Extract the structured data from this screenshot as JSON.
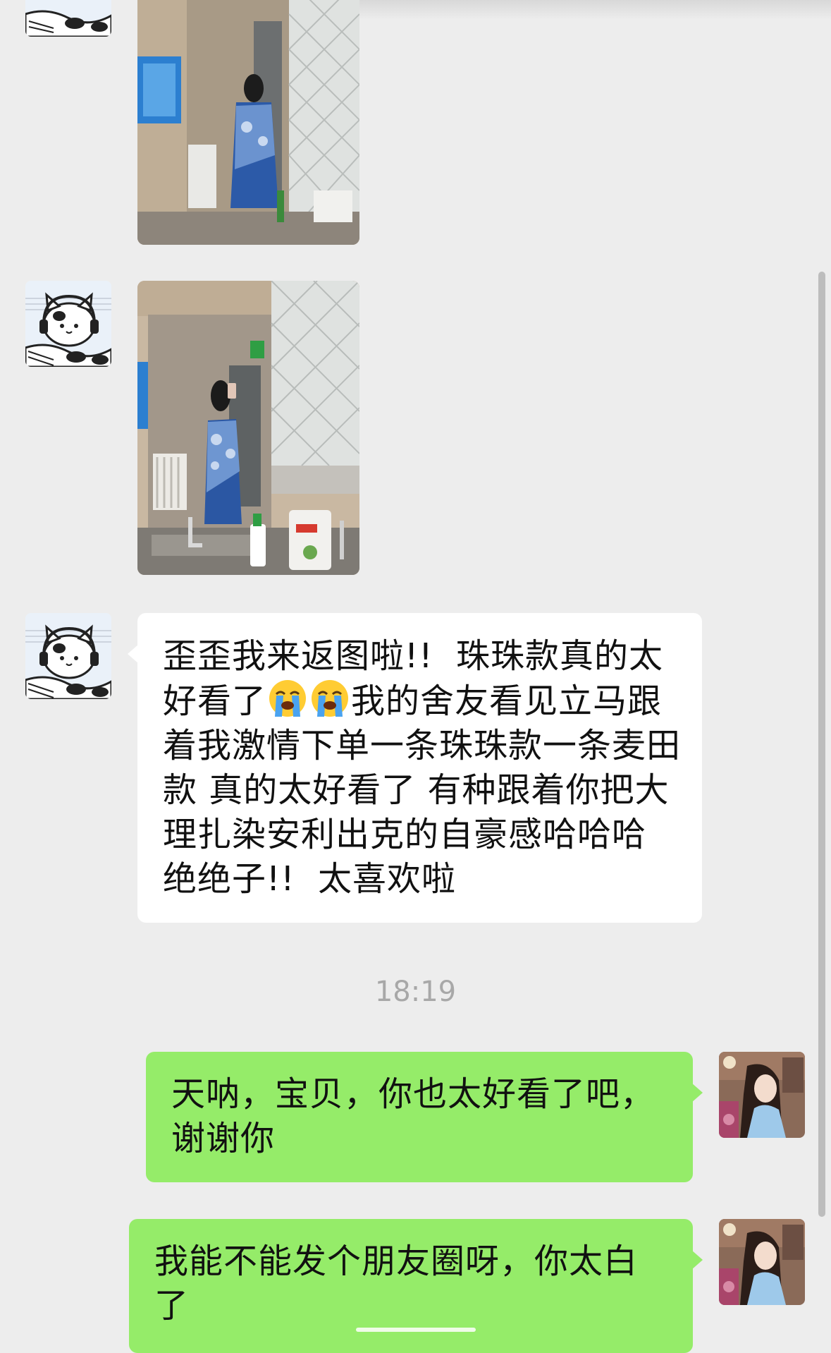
{
  "chat": {
    "timestamp": "18:19",
    "messages": [
      {
        "sender": "contact",
        "type": "image",
        "avatar_icon": "cow-cat-headphones-avatar"
      },
      {
        "sender": "contact",
        "type": "image",
        "avatar_icon": "cow-cat-headphones-avatar"
      },
      {
        "sender": "contact",
        "type": "text",
        "text_part1": "歪歪我来返图啦!!  珠珠款真的太好看了",
        "emoji_icon": "loudly-crying-face-emoji",
        "text_part2": "我的舍友看见立马跟着我激情下单一条珠珠款一条麦田款 真的太好看了 有种跟着你把大理扎染安利出克的自豪感哈哈哈 绝绝子!!  太喜欢啦"
      },
      {
        "sender": "me",
        "type": "text",
        "text": "天呐，宝贝，你也太好看了吧，谢谢你"
      },
      {
        "sender": "me",
        "type": "text",
        "text": "我能不能发个朋友圈呀，你太白了"
      }
    ]
  },
  "colors": {
    "background": "#ededed",
    "incoming_bubble": "#ffffff",
    "outgoing_bubble": "#95ec69",
    "timestamp_text": "#a8a8a8"
  }
}
